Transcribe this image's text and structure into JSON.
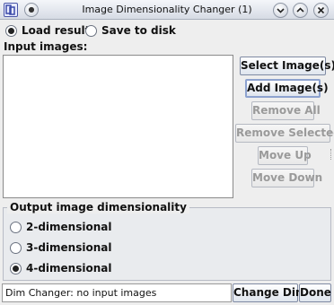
{
  "window": {
    "title": "Image Dimensionality Changer (1)"
  },
  "output_mode": {
    "options": [
      {
        "label": "Load result",
        "selected": true
      },
      {
        "label": "Save to disk",
        "selected": false
      }
    ]
  },
  "input_images": {
    "label": "Input images:",
    "items": []
  },
  "buttons": {
    "select_images": "Select Image(s)",
    "add_images": "Add Image(s)",
    "remove_all": "Remove All",
    "remove_selected": "Remove Selected",
    "move_up": "Move Up",
    "move_down": "Move Down",
    "change_dim": "Change Dim",
    "done": "Done"
  },
  "dimensionality": {
    "legend": "Output image dimensionality",
    "options": [
      {
        "label": "2-dimensional",
        "selected": false
      },
      {
        "label": "3-dimensional",
        "selected": false
      },
      {
        "label": "4-dimensional",
        "selected": true
      }
    ]
  },
  "status": {
    "text": "Dim Changer: no input images"
  },
  "icons": {
    "app": "app-icon",
    "menu": "window-menu-icon",
    "minimize": "chevron-down-icon",
    "maximize": "chevron-up-icon",
    "close": "close-icon"
  }
}
